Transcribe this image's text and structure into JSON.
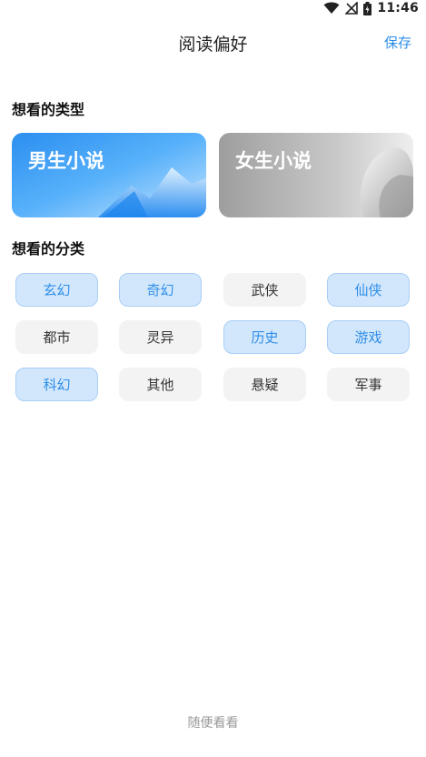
{
  "status_bar": {
    "time": "11:46",
    "icons": [
      "wifi-icon",
      "no-sim-icon",
      "battery-icon"
    ]
  },
  "header": {
    "title": "阅读偏好",
    "save_label": "保存"
  },
  "types_section": {
    "title": "想看的类型",
    "cards": [
      {
        "label": "男生小说",
        "selected": true
      },
      {
        "label": "女生小说",
        "selected": false
      }
    ]
  },
  "categories_section": {
    "title": "想看的分类",
    "chips": [
      {
        "label": "玄幻",
        "selected": true
      },
      {
        "label": "奇幻",
        "selected": true
      },
      {
        "label": "武侠",
        "selected": false
      },
      {
        "label": "仙侠",
        "selected": true
      },
      {
        "label": "都市",
        "selected": false
      },
      {
        "label": "灵异",
        "selected": false
      },
      {
        "label": "历史",
        "selected": true
      },
      {
        "label": "游戏",
        "selected": true
      },
      {
        "label": "科幻",
        "selected": true
      },
      {
        "label": "其他",
        "selected": false
      },
      {
        "label": "悬疑",
        "selected": false
      },
      {
        "label": "军事",
        "selected": false
      }
    ]
  },
  "footer": {
    "random_label": "随便看看"
  },
  "colors": {
    "accent": "#2f8ee8",
    "chip_selected_bg": "#d2e7fc",
    "chip_unselected_bg": "#f3f3f3"
  }
}
